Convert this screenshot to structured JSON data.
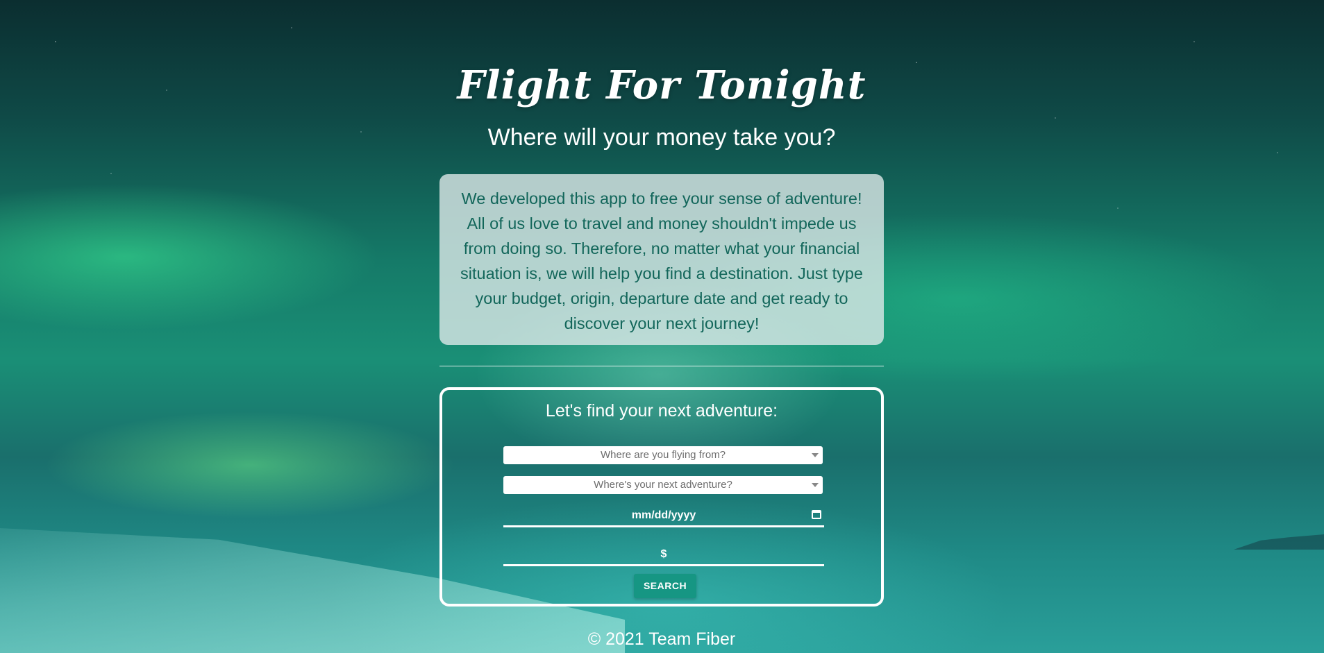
{
  "header": {
    "title": "Flight For Tonight",
    "subtitle": "Where will your money take you?"
  },
  "about": {
    "text": "We developed this app to free your sense of adventure! All of us love to travel and money shouldn't impede us from doing so. Therefore, no matter what your financial situation is, we will help you find a destination. Just type your budget, origin, departure date and get ready to discover your next journey!"
  },
  "search": {
    "heading": "Let's find your next adventure:",
    "origin_placeholder": "Where are you flying from?",
    "destination_placeholder": "Where's your next adventure?",
    "date_placeholder": "mm/dd/yyyy",
    "budget_placeholder": "$",
    "button_label": "SEARCH"
  },
  "footer": {
    "text": "© 2021 Team Fiber"
  },
  "colors": {
    "accent": "#169683",
    "about_text": "#12665a"
  },
  "icons": {
    "date": "calendar-icon",
    "select": "chevron-down-icon"
  }
}
